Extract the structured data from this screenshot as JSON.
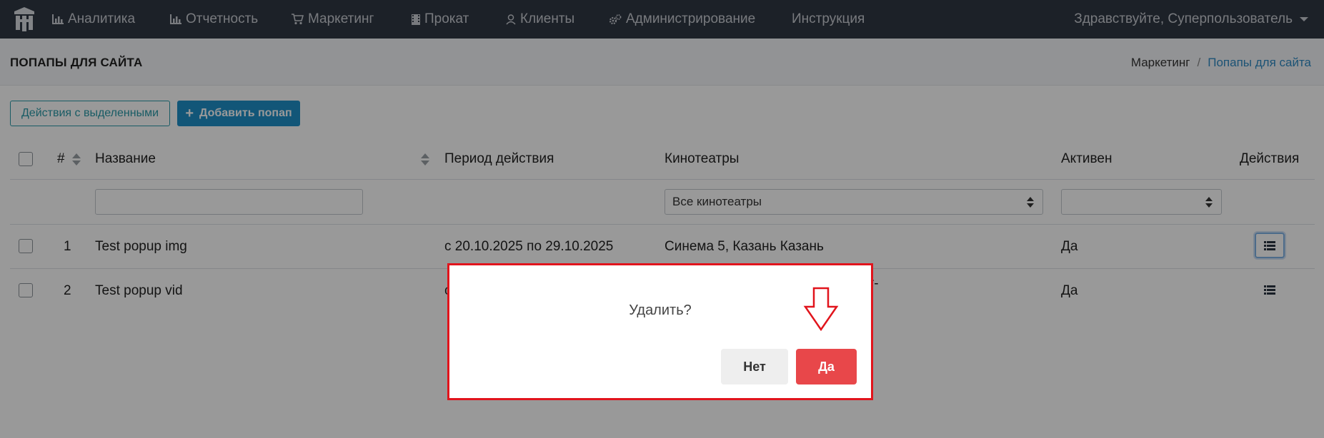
{
  "navbar": {
    "items": [
      {
        "label": "Аналитика",
        "icon": "bar-chart-icon"
      },
      {
        "label": "Отчетность",
        "icon": "bar-chart-icon"
      },
      {
        "label": "Маркетинг",
        "icon": "cart-icon"
      },
      {
        "label": "Прокат",
        "icon": "film-icon"
      },
      {
        "label": "Клиенты",
        "icon": "user-icon"
      },
      {
        "label": "Администрирование",
        "icon": "gears-icon"
      },
      {
        "label": "Инструкция",
        "icon": ""
      }
    ],
    "user_greeting": "Здравствуйте, Суперпользователь"
  },
  "page": {
    "title": "ПОПАПЫ ДЛЯ САЙТА",
    "breadcrumb": [
      "Маркетинг",
      "/",
      "Попапы для сайта"
    ]
  },
  "toolbar": {
    "bulk_actions_label": "Действия с выделенными",
    "add_label": "Добавить попап"
  },
  "table": {
    "headers": {
      "id": "#",
      "name": "Название",
      "period": "Период действия",
      "cinemas": "Кинотеатры",
      "active": "Активен",
      "actions": "Действия"
    },
    "filters": {
      "name_value": "",
      "cinemas_value": "Все кинотеатры",
      "active_value": ""
    },
    "rows": [
      {
        "id": "1",
        "name": "Test popup img",
        "period": "с 20.10.2025 по 29.10.2025",
        "cinemas": "Синема 5, Казань Казань",
        "active": "Да"
      },
      {
        "id": "2",
        "name": "Test popup vid",
        "period": "с",
        "cinemas": "кт-",
        "active": "Да"
      }
    ]
  },
  "modal": {
    "question": "Удалить?",
    "no_label": "Нет",
    "yes_label": "Да"
  },
  "colors": {
    "navbar": "#303744",
    "primary": "#1e8fc9",
    "outline": "#2b9aa8",
    "danger": "#e8474a",
    "annotation": "#e1141c"
  }
}
